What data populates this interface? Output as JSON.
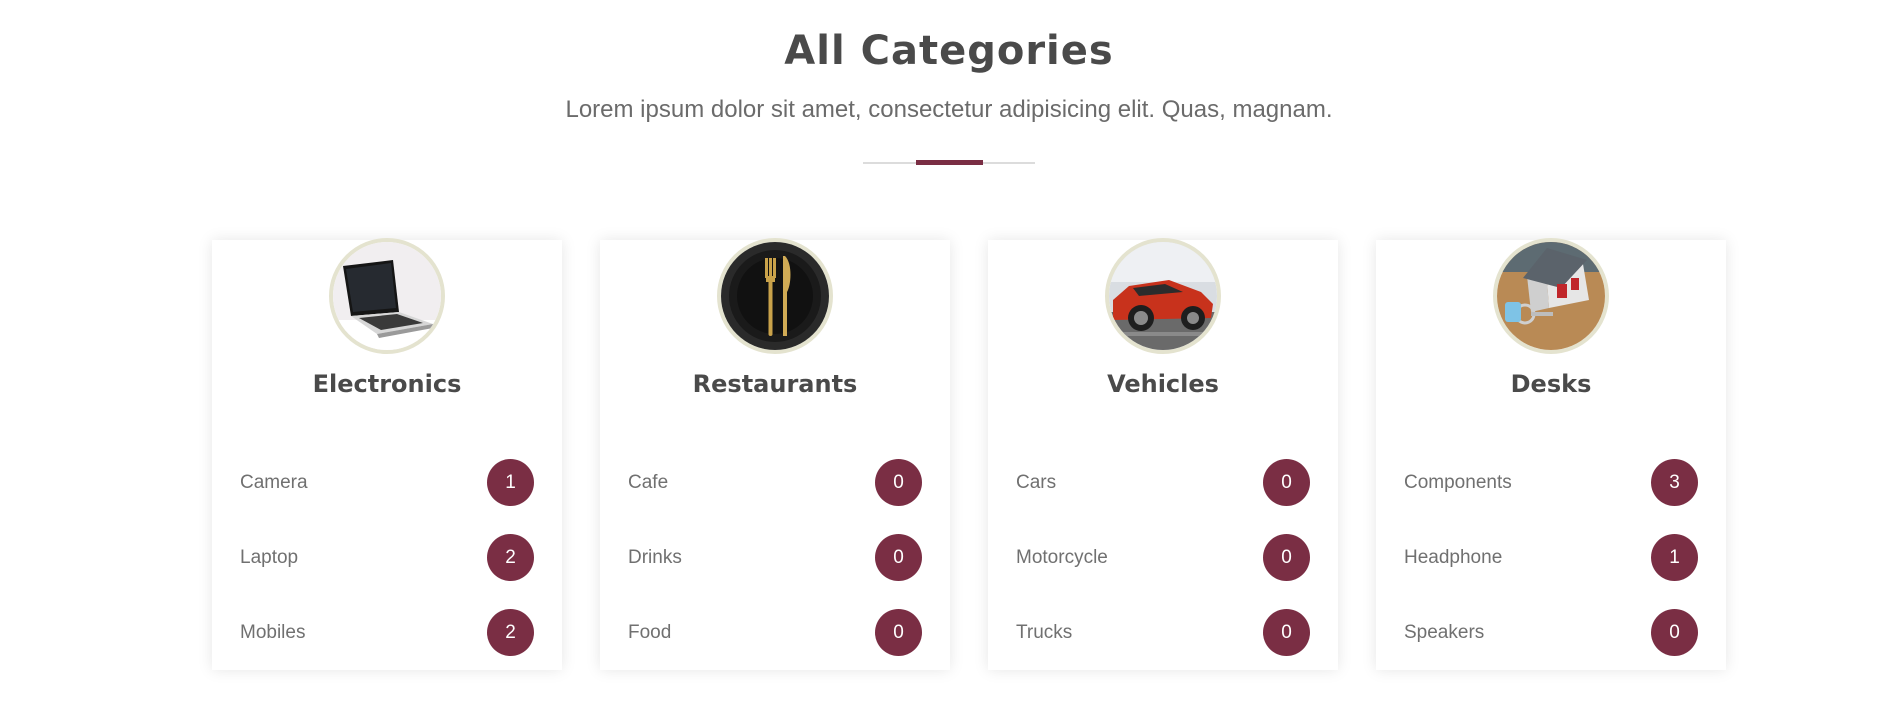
{
  "header": {
    "title": "All Categories",
    "subtitle": "Lorem ipsum dolor sit amet, consectetur adipisicing elit. Quas, magnam."
  },
  "colors": {
    "accent": "#7a2e44",
    "ring": "#e4e3cf"
  },
  "categories": [
    {
      "title": "Electronics",
      "icon": "laptop-icon",
      "items": [
        {
          "label": "Camera",
          "count": "1"
        },
        {
          "label": "Laptop",
          "count": "2"
        },
        {
          "label": "Mobiles",
          "count": "2"
        }
      ]
    },
    {
      "title": "Restaurants",
      "icon": "fork-knife-icon",
      "items": [
        {
          "label": "Cafe",
          "count": "0"
        },
        {
          "label": "Drinks",
          "count": "0"
        },
        {
          "label": "Food",
          "count": "0"
        }
      ]
    },
    {
      "title": "Vehicles",
      "icon": "car-icon",
      "items": [
        {
          "label": "Cars",
          "count": "0"
        },
        {
          "label": "Motorcycle",
          "count": "0"
        },
        {
          "label": "Trucks",
          "count": "0"
        }
      ]
    },
    {
      "title": "Desks",
      "icon": "house-icon",
      "items": [
        {
          "label": "Components",
          "count": "3"
        },
        {
          "label": "Headphone",
          "count": "1"
        },
        {
          "label": "Speakers",
          "count": "0"
        }
      ]
    }
  ]
}
